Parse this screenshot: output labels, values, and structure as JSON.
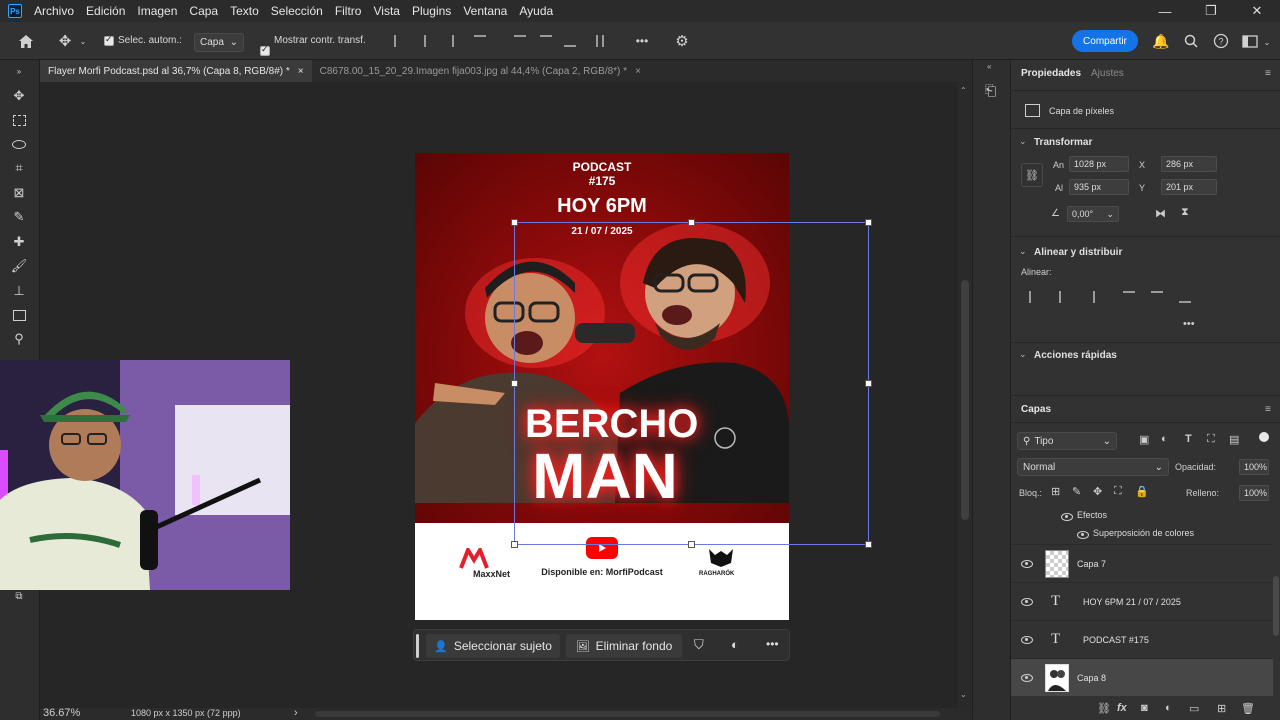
{
  "menubar": {
    "logo": "Ps",
    "items": [
      "Archivo",
      "Edición",
      "Imagen",
      "Capa",
      "Texto",
      "Selección",
      "Filtro",
      "Vista",
      "Plugins",
      "Ventana",
      "Ayuda"
    ],
    "window_controls": {
      "minimize": "—",
      "restore": "❐",
      "close": "✕"
    }
  },
  "optionsbar": {
    "auto_select_label": "Selec. autom.:",
    "auto_select_target": "Capa",
    "show_transform_label": "Mostrar contr. transf.",
    "more": "•••",
    "share_label": "Compartir"
  },
  "tabs": [
    {
      "label": "Flayer Morfi Podcast.psd al 36,7% (Capa 8, RGB/8#) *",
      "close": "×",
      "active": true
    },
    {
      "label": "C8678.00_15_20_29.Imagen fija003.jpg al 44,4% (Capa 2, RGB/8*) *",
      "close": "×",
      "active": false
    }
  ],
  "poster": {
    "podcast": "PODCAST",
    "episode": "#175",
    "time": "HOY 6PM",
    "date": "21 / 07 / 2025",
    "title_line1": "BERCHO",
    "title_line2": "MAN",
    "sponsor_left": "MaxxNet",
    "available": "Disponible en: MorfiPodcast",
    "sponsor_right": "RAGHARÖK",
    "colors": {
      "red": "#b21111",
      "dark_red": "#5a0505",
      "youtube": "#ff0000"
    }
  },
  "context_bar": {
    "select_subject": "Seleccionar sujeto",
    "remove_bg": "Eliminar fondo",
    "more": "•••"
  },
  "statusbar": {
    "zoom": "36.67%",
    "doc_info": "1080 px x 1350 px (72 ppp)",
    "arrow": "›"
  },
  "properties": {
    "tab_active": "Propiedades",
    "tab_inactive": "Ajustes",
    "layer_kind": "Capa de píxeles",
    "transform_title": "Transformar",
    "width_label": "An",
    "width": "1028 px",
    "height_label": "Al",
    "height": "935 px",
    "x_label": "X",
    "x": "286 px",
    "y_label": "Y",
    "y": "201 px",
    "angle": "0,00°",
    "align_title": "Alinear y distribuir",
    "align_label": "Alinear:",
    "more": "•••",
    "quick_actions": "Acciones rápidas"
  },
  "layers": {
    "title": "Capas",
    "filter": "Tipo",
    "blend_mode": "Normal",
    "opacity_label": "Opacidad:",
    "opacity": "100%",
    "lock_label": "Bloq.:",
    "fill_label": "Relleno:",
    "fill": "100%",
    "effects": "Efectos",
    "effect_item": "Superposición de colores",
    "rows": [
      {
        "name": "Capa 7",
        "kind": "pixel"
      },
      {
        "name": "HOY 6PM 21 / 07 / 2025",
        "kind": "text"
      },
      {
        "name": "PODCAST #175",
        "kind": "text"
      },
      {
        "name": "Capa 8",
        "kind": "pixel",
        "selected": true
      }
    ],
    "type_glyph": "T",
    "bottom_icons": [
      "link-icon",
      "fx-icon",
      "mask-icon",
      "adjustment-icon",
      "group-icon",
      "new-layer-icon",
      "trash-icon"
    ]
  }
}
